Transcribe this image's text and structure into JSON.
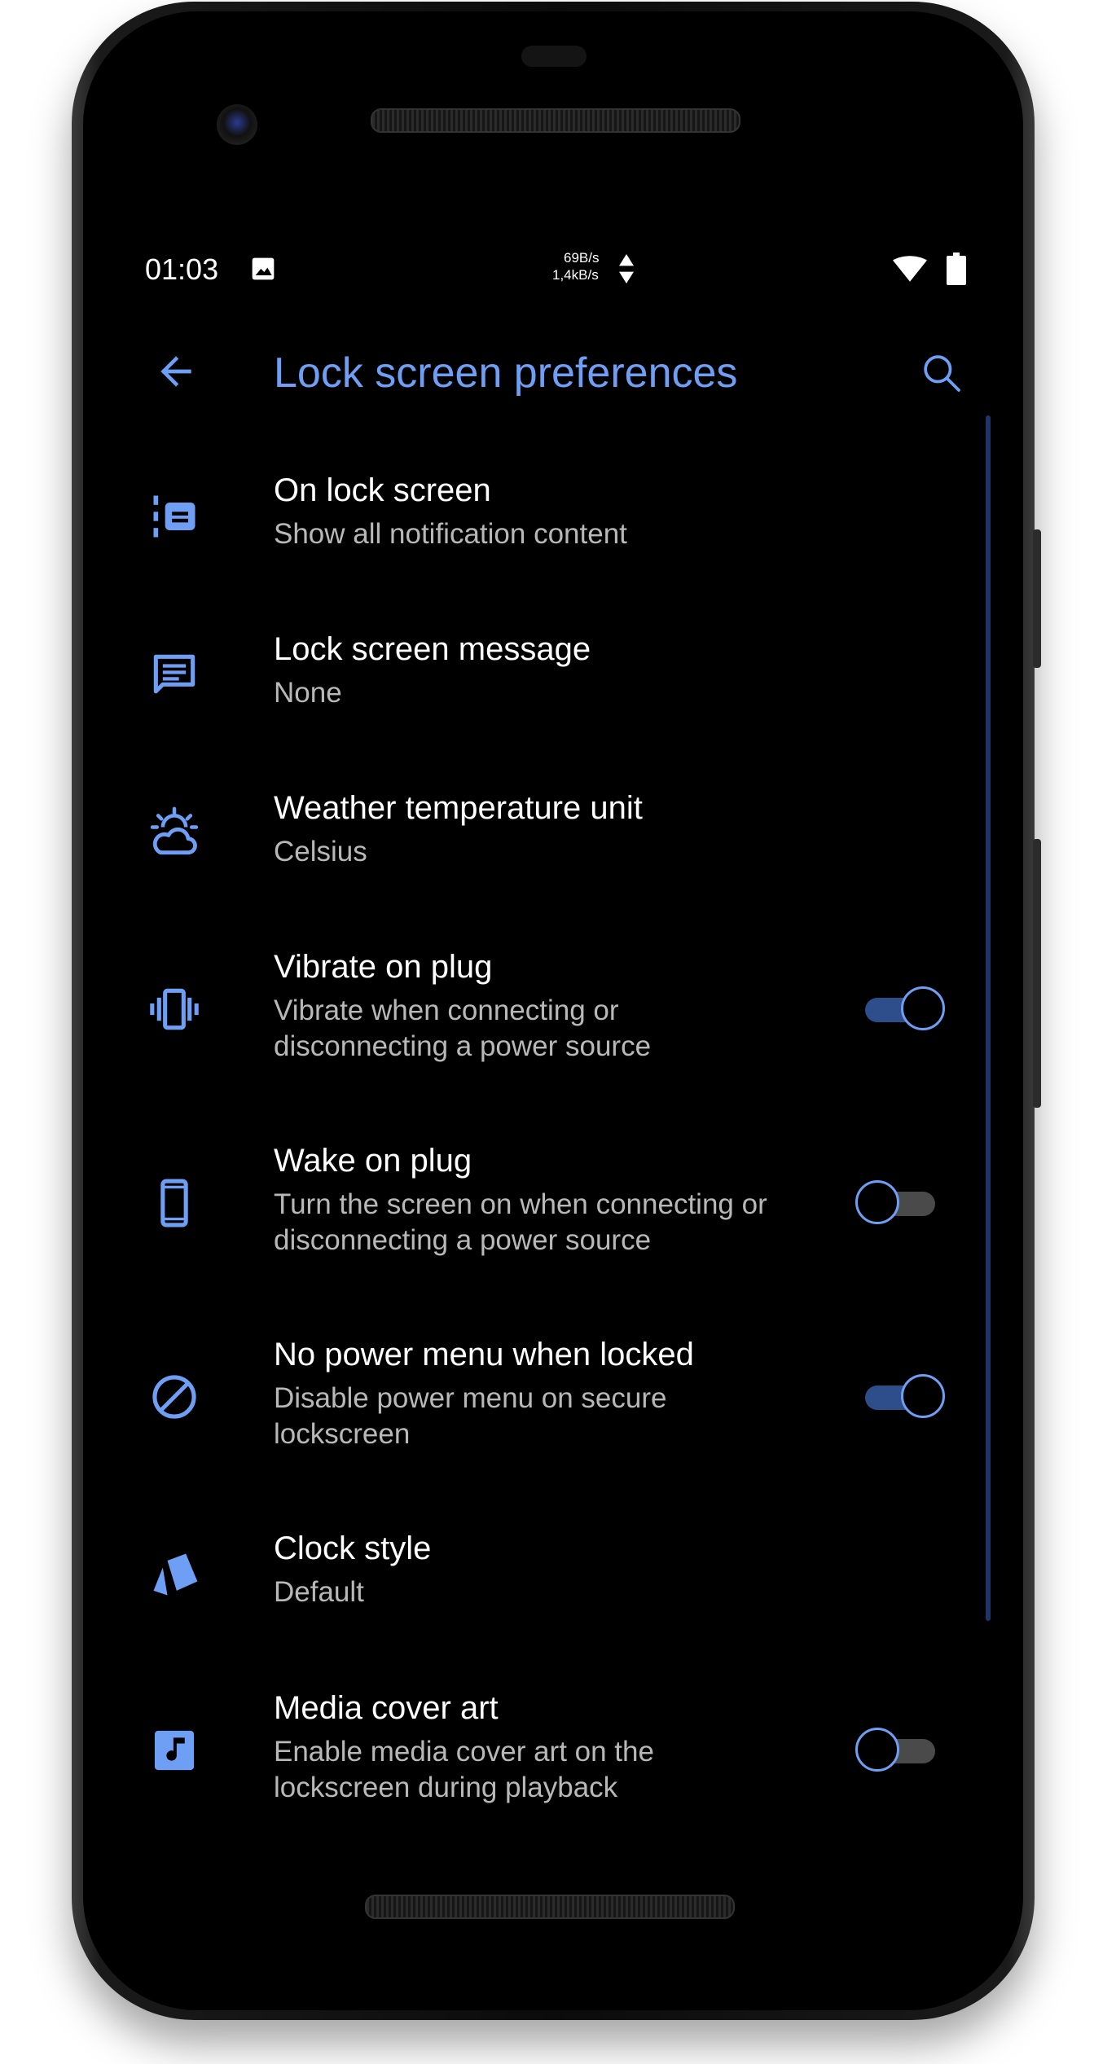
{
  "status_bar": {
    "time": "01:03",
    "net_up": "69B/s",
    "net_down": "1,4kB/s",
    "icons": [
      "image-icon",
      "data-arrows-icon",
      "wifi-icon",
      "battery-icon"
    ]
  },
  "app_bar": {
    "title": "Lock screen preferences",
    "back_icon": "arrow-back-icon",
    "search_icon": "search-icon"
  },
  "colors": {
    "accent": "#6e9ff5",
    "background": "#000000",
    "subtitle": "#b8b8b8",
    "toggle_track_on": "#2e4d8b",
    "toggle_track_off": "#4a4a4a"
  },
  "settings": [
    {
      "icon": "notification-list-icon",
      "title": "On lock screen",
      "subtitle": [
        "Show all notification content"
      ],
      "toggle": null
    },
    {
      "icon": "message-icon",
      "title": "Lock screen message",
      "subtitle": [
        "None"
      ],
      "toggle": null
    },
    {
      "icon": "weather-icon",
      "title": "Weather temperature unit",
      "subtitle": [
        "Celsius"
      ],
      "toggle": null
    },
    {
      "icon": "vibration-icon",
      "title": "Vibrate on plug",
      "subtitle": [
        "Vibrate when connecting or",
        "disconnecting a power source"
      ],
      "toggle": true
    },
    {
      "icon": "phone-icon",
      "title": "Wake on plug",
      "subtitle": [
        "Turn the screen on when connecting or",
        "disconnecting a power source"
      ],
      "toggle": false
    },
    {
      "icon": "block-icon",
      "title": "No power menu when locked",
      "subtitle": [
        "Disable power menu on secure",
        "lockscreen"
      ],
      "toggle": true
    },
    {
      "icon": "style-icon",
      "title": "Clock style",
      "subtitle": [
        "Default"
      ],
      "toggle": null
    },
    {
      "icon": "music-note-icon",
      "title": "Media cover art",
      "subtitle": [
        "Enable media cover art on the",
        "lockscreen during playback"
      ],
      "toggle": false
    }
  ]
}
